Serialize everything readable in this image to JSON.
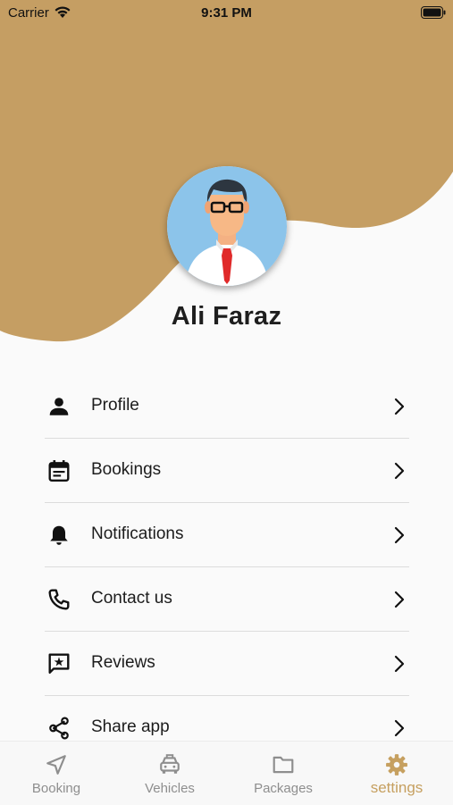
{
  "status_bar": {
    "carrier": "Carrier",
    "time": "9:31 PM"
  },
  "profile": {
    "name": "Ali Faraz"
  },
  "menu": {
    "items": [
      {
        "label": "Profile",
        "icon": "person-icon"
      },
      {
        "label": "Bookings",
        "icon": "calendar-icon"
      },
      {
        "label": "Notifications",
        "icon": "bell-icon"
      },
      {
        "label": "Contact us",
        "icon": "phone-icon"
      },
      {
        "label": "Reviews",
        "icon": "review-icon"
      },
      {
        "label": "Share app",
        "icon": "share-icon"
      }
    ]
  },
  "tabs": [
    {
      "label": "Booking",
      "icon": "navigation-arrow-icon",
      "active": false
    },
    {
      "label": "Vehicles",
      "icon": "taxi-icon",
      "active": false
    },
    {
      "label": "Packages",
      "icon": "folder-icon",
      "active": false
    },
    {
      "label": "settings",
      "icon": "gear-icon",
      "active": true
    }
  ],
  "colors": {
    "accent": "#c6a060",
    "background": "#fafafa",
    "inactive_tab": "#8e8e8e"
  }
}
